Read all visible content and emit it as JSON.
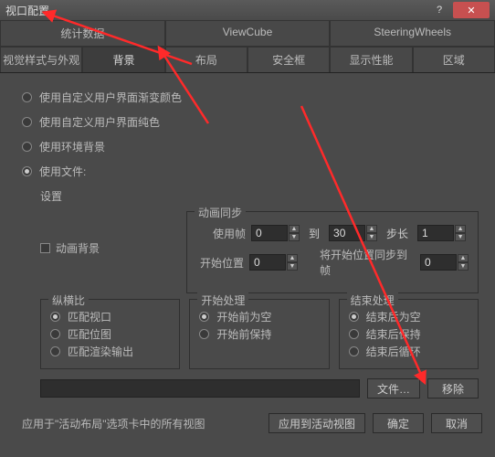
{
  "window": {
    "title": "视口配置"
  },
  "tabs_top": [
    "统计数据",
    "ViewCube",
    "SteeringWheels"
  ],
  "tabs_bottom": [
    "视觉样式与外观",
    "背景",
    "布局",
    "安全框",
    "显示性能",
    "区域"
  ],
  "active_tab": "背景",
  "radios": {
    "gradient": "使用自定义用户界面渐变颜色",
    "solid": "使用自定义用户界面纯色",
    "env": "使用环境背景",
    "file": "使用文件:"
  },
  "settings_label": "设置",
  "anim_sync": {
    "legend": "动画同步",
    "use_frame": "使用帧",
    "to": "到",
    "step": "步长",
    "start_pos": "开始位置",
    "sync_start": "将开始位置同步到帧",
    "v_useframe": "0",
    "v_to": "30",
    "v_step": "1",
    "v_start": "0",
    "v_sync": "0"
  },
  "anim_bg_label": "动画背景",
  "aspect": {
    "legend": "纵横比",
    "opt1": "匹配视口",
    "opt2": "匹配位图",
    "opt3": "匹配渲染输出"
  },
  "start_proc": {
    "legend": "开始处理",
    "opt1": "开始前为空",
    "opt2": "开始前保持"
  },
  "end_proc": {
    "legend": "结束处理",
    "opt1": "结束后为空",
    "opt2": "结束后保持",
    "opt3": "结束后循环"
  },
  "buttons": {
    "file": "文件…",
    "remove": "移除",
    "apply_active": "应用到活动视图",
    "ok": "确定",
    "cancel": "取消"
  },
  "hint": "应用于\"活动布局\"选项卡中的所有视图"
}
